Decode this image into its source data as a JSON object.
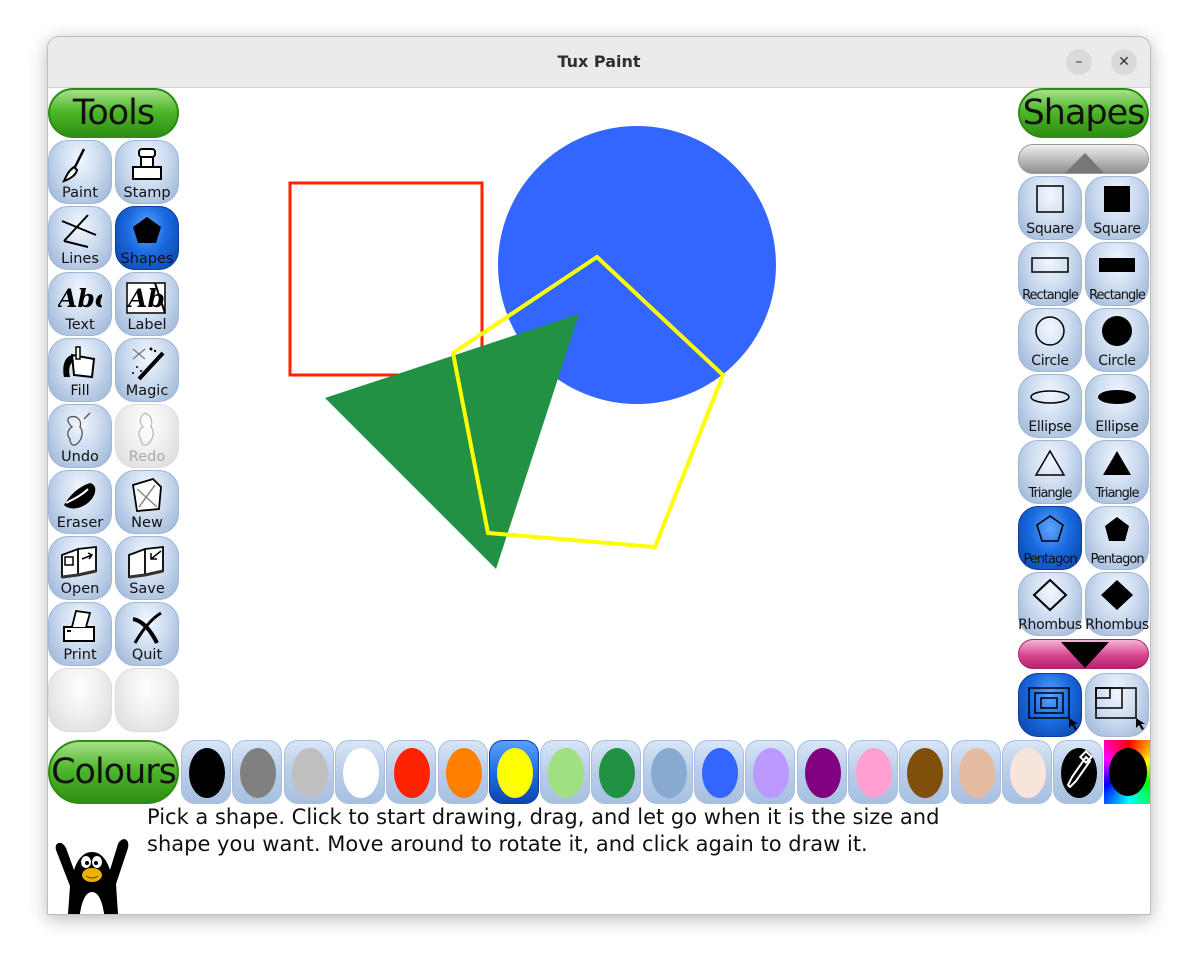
{
  "window": {
    "title": "Tux Paint",
    "minimize_label": "–",
    "close_label": "✕"
  },
  "tools_panel": {
    "title": "Tools",
    "items": [
      {
        "label": "Paint",
        "icon": "paintbrush-icon",
        "state": "normal"
      },
      {
        "label": "Stamp",
        "icon": "stamp-icon",
        "state": "normal"
      },
      {
        "label": "Lines",
        "icon": "lines-icon",
        "state": "normal"
      },
      {
        "label": "Shapes",
        "icon": "pentagon-icon",
        "state": "selected"
      },
      {
        "label": "Text",
        "icon": "text-abc-icon",
        "state": "normal"
      },
      {
        "label": "Label",
        "icon": "label-abc-icon",
        "state": "normal"
      },
      {
        "label": "Fill",
        "icon": "paint-bucket-icon",
        "state": "normal"
      },
      {
        "label": "Magic",
        "icon": "magic-wand-icon",
        "state": "normal"
      },
      {
        "label": "Undo",
        "icon": "undo-hand-icon",
        "state": "normal"
      },
      {
        "label": "Redo",
        "icon": "redo-hand-icon",
        "state": "disabled"
      },
      {
        "label": "Eraser",
        "icon": "eraser-icon",
        "state": "normal"
      },
      {
        "label": "New",
        "icon": "new-page-icon",
        "state": "normal"
      },
      {
        "label": "Open",
        "icon": "open-book-icon",
        "state": "normal"
      },
      {
        "label": "Save",
        "icon": "save-book-icon",
        "state": "normal"
      },
      {
        "label": "Print",
        "icon": "printer-icon",
        "state": "normal"
      },
      {
        "label": "Quit",
        "icon": "quit-x-icon",
        "state": "normal"
      }
    ]
  },
  "shapes_panel": {
    "title": "Shapes",
    "items": [
      {
        "label": "Square",
        "icon": "square-outline-icon",
        "state": "normal"
      },
      {
        "label": "Square",
        "icon": "square-filled-icon",
        "state": "normal"
      },
      {
        "label": "Rectangle",
        "icon": "rectangle-outline-icon",
        "state": "normal"
      },
      {
        "label": "Rectangle",
        "icon": "rectangle-filled-icon",
        "state": "normal"
      },
      {
        "label": "Circle",
        "icon": "circle-outline-icon",
        "state": "normal"
      },
      {
        "label": "Circle",
        "icon": "circle-filled-icon",
        "state": "normal"
      },
      {
        "label": "Ellipse",
        "icon": "ellipse-outline-icon",
        "state": "normal"
      },
      {
        "label": "Ellipse",
        "icon": "ellipse-filled-icon",
        "state": "normal"
      },
      {
        "label": "Triangle",
        "icon": "triangle-outline-icon",
        "state": "normal"
      },
      {
        "label": "Triangle",
        "icon": "triangle-filled-icon",
        "state": "normal"
      },
      {
        "label": "Pentagon",
        "icon": "pentagon-outline-icon",
        "state": "selected"
      },
      {
        "label": "Pentagon",
        "icon": "pentagon-filled-icon",
        "state": "normal"
      },
      {
        "label": "Rhombus",
        "icon": "rhombus-outline-icon",
        "state": "normal"
      },
      {
        "label": "Rhombus",
        "icon": "rhombus-filled-icon",
        "state": "normal"
      }
    ],
    "mode_buttons": [
      {
        "icon": "shape-from-center-icon",
        "state": "selected"
      },
      {
        "icon": "shape-from-corner-icon",
        "state": "normal"
      }
    ]
  },
  "colours": {
    "title": "Colours",
    "selected_index": 6,
    "swatches": [
      {
        "name": "black",
        "hex": "#000000"
      },
      {
        "name": "dark-grey",
        "hex": "#808080"
      },
      {
        "name": "light-grey",
        "hex": "#bfbfbf"
      },
      {
        "name": "white",
        "hex": "#ffffff"
      },
      {
        "name": "red",
        "hex": "#ff2200"
      },
      {
        "name": "orange",
        "hex": "#ff7f00"
      },
      {
        "name": "yellow",
        "hex": "#ffff00"
      },
      {
        "name": "light-green",
        "hex": "#a0e080"
      },
      {
        "name": "dark-green",
        "hex": "#219144"
      },
      {
        "name": "sky-blue",
        "hex": "#88aad0"
      },
      {
        "name": "blue",
        "hex": "#3366ff"
      },
      {
        "name": "lavender",
        "hex": "#bb99ff"
      },
      {
        "name": "purple",
        "hex": "#800080"
      },
      {
        "name": "pink",
        "hex": "#ffa0d0"
      },
      {
        "name": "brown",
        "hex": "#80500a"
      },
      {
        "name": "tan",
        "hex": "#e4bba0"
      },
      {
        "name": "beige",
        "hex": "#f7e4da"
      }
    ],
    "picker_icon": "color-dropper-icon",
    "rainbow_icon": "color-wheel-icon"
  },
  "canvas": {
    "shapes": [
      {
        "type": "square-outline",
        "color": "#ff2200"
      },
      {
        "type": "circle-filled",
        "color": "#3366ff"
      },
      {
        "type": "triangle-filled",
        "color": "#219144"
      },
      {
        "type": "pentagon-outline",
        "color": "#ffff00"
      }
    ]
  },
  "status": {
    "message_line1": "Pick a shape. Click to start drawing, drag, and let go when it is the size and",
    "message_line2": "shape you want. Move around to rotate it, and click again to draw it.",
    "mascot": "tux-penguin-icon"
  }
}
